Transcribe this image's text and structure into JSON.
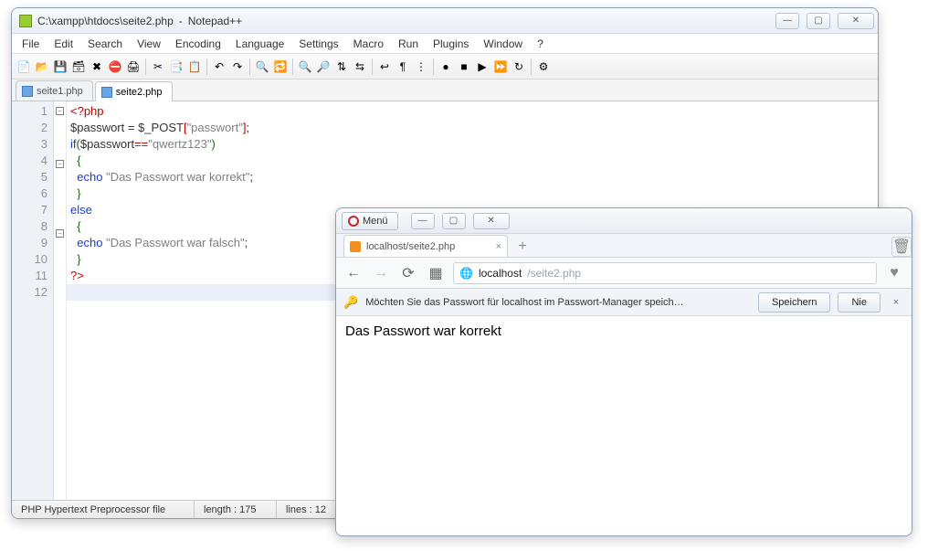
{
  "npp": {
    "title_path": "C:\\xampp\\htdocs\\seite2.php",
    "title_app": "Notepad++",
    "menus": [
      "File",
      "Edit",
      "Search",
      "View",
      "Encoding",
      "Language",
      "Settings",
      "Macro",
      "Run",
      "Plugins",
      "Window",
      "?"
    ],
    "toolbar_icons": [
      "new-file",
      "open-file",
      "save",
      "save-all",
      "close",
      "close-all",
      "print",
      "|",
      "cut",
      "copy",
      "paste",
      "|",
      "undo",
      "redo",
      "|",
      "find",
      "replace",
      "|",
      "zoom-in",
      "zoom-out",
      "sync-v",
      "sync-h",
      "|",
      "wrap",
      "show-all",
      "indent-guide",
      "|",
      "macro-record",
      "macro-stop",
      "macro-play",
      "macro-fast",
      "macro-loop",
      "|",
      "preferences"
    ],
    "icon_glyphs": {
      "new-file": "📄",
      "open-file": "📂",
      "save": "💾",
      "save-all": "🗃",
      "close": "✖",
      "close-all": "⛔",
      "print": "🖨",
      "cut": "✂",
      "copy": "📑",
      "paste": "📋",
      "undo": "↶",
      "redo": "↷",
      "find": "🔍",
      "replace": "🔁",
      "zoom-in": "🔍",
      "zoom-out": "🔎",
      "sync-v": "⇅",
      "sync-h": "⇆",
      "wrap": "↩",
      "show-all": "¶",
      "indent-guide": "⋮",
      "macro-record": "●",
      "macro-stop": "■",
      "macro-play": "▶",
      "macro-fast": "⏩",
      "macro-loop": "↻",
      "preferences": "⚙"
    },
    "tabs": [
      {
        "label": "seite1.php",
        "active": false
      },
      {
        "label": "seite2.php",
        "active": true
      }
    ],
    "lines": [
      {
        "n": 1,
        "fold": "-",
        "tokens": [
          [
            "tag",
            "<?php"
          ]
        ]
      },
      {
        "n": 2,
        "fold": "",
        "tokens": [
          [
            "var",
            "$passwort"
          ],
          [
            "var",
            " = "
          ],
          [
            "var",
            "$_POST"
          ],
          [
            "op",
            "["
          ],
          [
            "str",
            "\"passwort\""
          ],
          [
            "op",
            "]"
          ],
          [
            "var",
            ";"
          ]
        ]
      },
      {
        "n": 3,
        "fold": "",
        "tokens": [
          [
            "kw",
            "if"
          ],
          [
            "par",
            "("
          ],
          [
            "var",
            "$passwort"
          ],
          [
            "op",
            "=="
          ],
          [
            "str",
            "\"qwertz123\""
          ],
          [
            "par",
            ")"
          ]
        ]
      },
      {
        "n": 4,
        "fold": "-",
        "tokens": [
          [
            "par",
            "  {"
          ]
        ]
      },
      {
        "n": 5,
        "fold": "",
        "tokens": [
          [
            "var",
            "  "
          ],
          [
            "kw",
            "echo"
          ],
          [
            "var",
            " "
          ],
          [
            "str",
            "\"Das Passwort war korrekt\""
          ],
          [
            "var",
            ";"
          ]
        ]
      },
      {
        "n": 6,
        "fold": "",
        "tokens": [
          [
            "par",
            "  }"
          ]
        ]
      },
      {
        "n": 7,
        "fold": "",
        "tokens": [
          [
            "kw",
            "else"
          ]
        ]
      },
      {
        "n": 8,
        "fold": "-",
        "tokens": [
          [
            "par",
            "  {"
          ]
        ]
      },
      {
        "n": 9,
        "fold": "",
        "tokens": [
          [
            "var",
            "  "
          ],
          [
            "kw",
            "echo"
          ],
          [
            "var",
            " "
          ],
          [
            "str",
            "\"Das Passwort war falsch\""
          ],
          [
            "var",
            ";"
          ]
        ]
      },
      {
        "n": 10,
        "fold": "",
        "tokens": [
          [
            "par",
            "  }"
          ]
        ]
      },
      {
        "n": 11,
        "fold": "",
        "tokens": [
          [
            "tag",
            "?>"
          ]
        ]
      },
      {
        "n": 12,
        "fold": "",
        "tokens": [
          [
            "var",
            ""
          ]
        ]
      }
    ],
    "current_line": 12,
    "status": {
      "lang": "PHP Hypertext Preprocessor file",
      "length": "length : 175",
      "lines": "lines : 12"
    }
  },
  "browser": {
    "menu_label": "Menü",
    "tab_title": "localhost/seite2.php",
    "newtab_glyph": "+",
    "url_host": "localhost",
    "url_path": "/seite2.php",
    "infobar_text": "Möchten Sie das Passwort für localhost im Passwort-Manager speich…",
    "btn_save": "Speichern",
    "btn_never": "Nie",
    "page_text": "Das Passwort war korrekt"
  },
  "win_controls": {
    "min": "—",
    "max": "▢",
    "close": "✕"
  }
}
